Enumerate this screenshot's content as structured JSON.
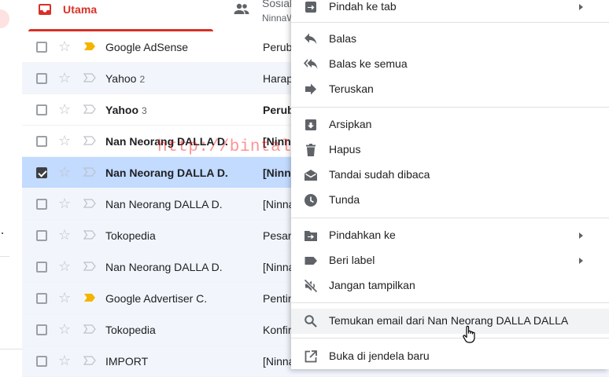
{
  "tabs": {
    "primary": {
      "label": "Utama"
    },
    "social": {
      "label": "Sosial",
      "sub": "NinnaW"
    }
  },
  "emails": [
    {
      "sender": "Google AdSense",
      "count": "",
      "subject": "Perub",
      "sender_bold": false,
      "subject_bold": false,
      "important": true,
      "selected": false,
      "read": false
    },
    {
      "sender": "Yahoo",
      "count": "2",
      "subject": "Harap",
      "sender_bold": false,
      "subject_bold": false,
      "important": false,
      "selected": false,
      "read": true
    },
    {
      "sender": "Yahoo",
      "count": "3",
      "subject": "Perub",
      "sender_bold": true,
      "subject_bold": true,
      "important": false,
      "selected": false,
      "read": false
    },
    {
      "sender": "Nan Neorang DALLA D.",
      "count": "",
      "subject": "[Ninna",
      "sender_bold": true,
      "subject_bold": true,
      "important": false,
      "selected": false,
      "read": false
    },
    {
      "sender": "Nan Neorang DALLA D.",
      "count": "",
      "subject": "[Ninna",
      "sender_bold": true,
      "subject_bold": true,
      "important": false,
      "selected": true,
      "read": false
    },
    {
      "sender": "Nan Neorang DALLA D.",
      "count": "",
      "subject": "[Ninna",
      "sender_bold": false,
      "subject_bold": false,
      "important": false,
      "selected": false,
      "read": true
    },
    {
      "sender": "Tokopedia",
      "count": "",
      "subject": "Pesar",
      "sender_bold": false,
      "subject_bold": false,
      "important": false,
      "selected": false,
      "read": true
    },
    {
      "sender": "Nan Neorang DALLA D.",
      "count": "",
      "subject": "[Ninna",
      "sender_bold": false,
      "subject_bold": false,
      "important": false,
      "selected": false,
      "read": true
    },
    {
      "sender": "Google Advertiser C.",
      "count": "",
      "subject": "Pentin",
      "sender_bold": false,
      "subject_bold": false,
      "important": true,
      "selected": false,
      "read": true
    },
    {
      "sender": "Tokopedia",
      "count": "",
      "subject": "Konfir",
      "sender_bold": false,
      "subject_bold": false,
      "important": false,
      "selected": false,
      "read": true
    },
    {
      "sender": "IMPORT",
      "count": "",
      "subject": "[Ninna",
      "sender_bold": false,
      "subject_bold": false,
      "important": false,
      "selected": false,
      "read": true
    }
  ],
  "context_menu": {
    "move_to_tab": "Pindah ke tab",
    "reply": "Balas",
    "reply_all": "Balas ke semua",
    "forward": "Teruskan",
    "archive": "Arsipkan",
    "delete": "Hapus",
    "mark_read": "Tandai sudah dibaca",
    "snooze": "Tunda",
    "move_to": "Pindahkan ke",
    "label_as": "Beri label",
    "mute": "Jangan tampilkan",
    "find_emails": "Temukan email dari Nan Neorang DALLA DALLA",
    "open_new_window": "Buka di jendela baru"
  },
  "watermark": "http://bintalanet.blogspot.com/",
  "colors": {
    "accent": "#d93025",
    "important": "#f4b400",
    "selected_row": "#c2dbff",
    "read_row": "#f2f6fc",
    "icon": "#5f6368"
  }
}
